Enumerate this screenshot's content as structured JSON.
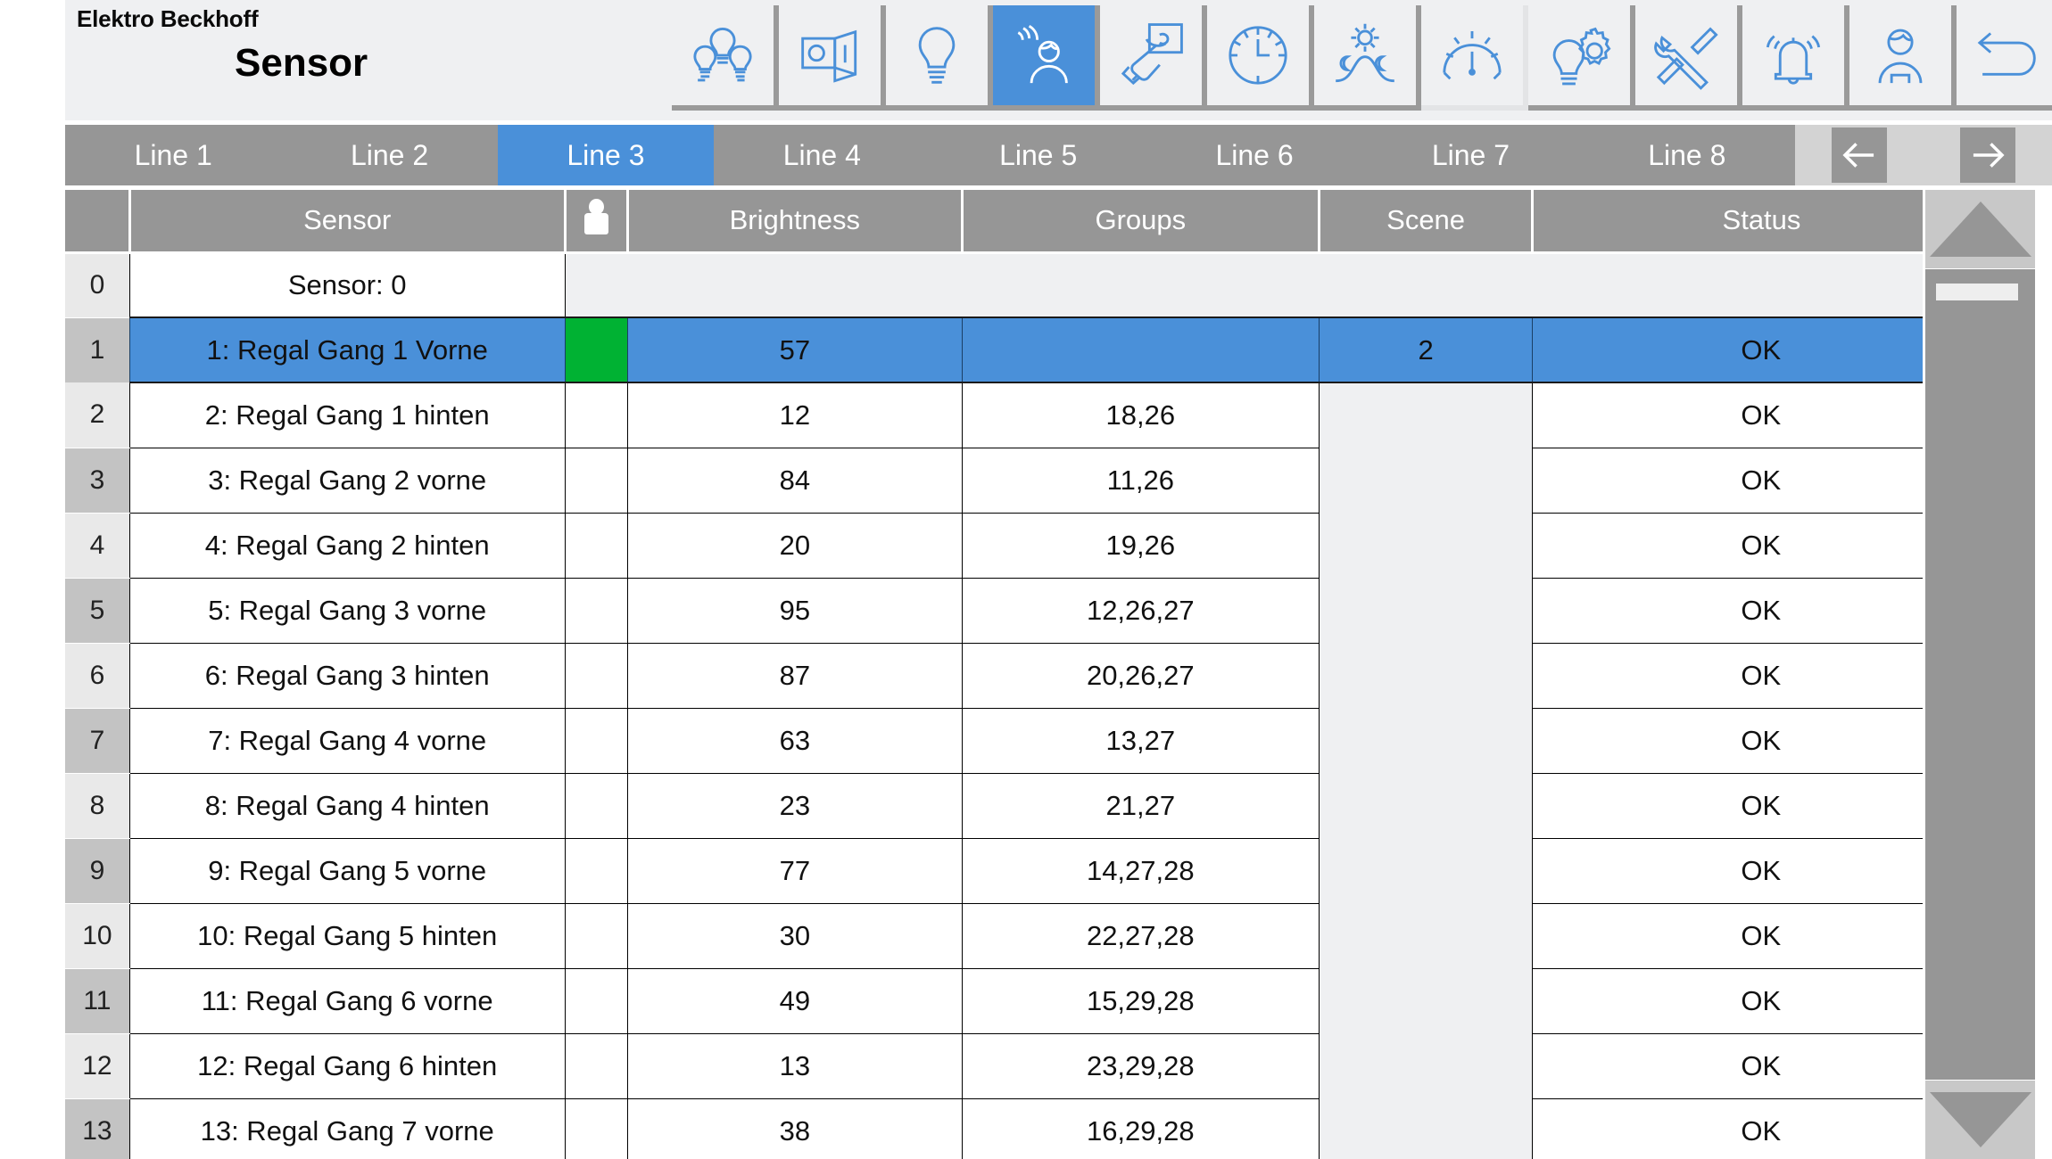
{
  "header": {
    "company": "Elektro Beckhoff",
    "title": "Sensor",
    "toolbar_buttons": [
      {
        "icon": "lamp-group-icon",
        "label": "Lamp groups",
        "active": false
      },
      {
        "icon": "display-panel-icon",
        "label": "Display panel",
        "active": false
      },
      {
        "icon": "lightbulb-icon",
        "label": "Light",
        "active": false
      },
      {
        "icon": "presence-sensor-icon",
        "label": "Sensor",
        "active": true
      },
      {
        "icon": "hand-switch-icon",
        "label": "Switch",
        "active": false
      },
      {
        "icon": "clock-icon",
        "label": "Time schedule",
        "active": false
      },
      {
        "icon": "sun-moon-curve-icon",
        "label": "Daylight curve",
        "active": false
      },
      {
        "icon": "gauge-icon",
        "label": "Gauge",
        "active": false
      },
      {
        "icon": "lightbulb-gear-icon",
        "label": "Light settings",
        "active": false
      },
      {
        "icon": "tools-icon",
        "label": "Service",
        "active": false
      },
      {
        "icon": "bell-alarm-icon",
        "label": "Alarms",
        "active": false
      },
      {
        "icon": "user-icon",
        "label": "User",
        "active": false
      },
      {
        "icon": "back-arrow-icon",
        "label": "Back",
        "active": false
      }
    ]
  },
  "line_tabs": {
    "items": [
      {
        "label": "Line 1",
        "active": false
      },
      {
        "label": "Line 2",
        "active": false
      },
      {
        "label": "Line 3",
        "active": true
      },
      {
        "label": "Line 4",
        "active": false
      },
      {
        "label": "Line 5",
        "active": false
      },
      {
        "label": "Line 6",
        "active": false
      },
      {
        "label": "Line 7",
        "active": false
      },
      {
        "label": "Line 8",
        "active": false
      }
    ],
    "prev_icon": "arrow-left-icon",
    "next_icon": "arrow-right-icon"
  },
  "table": {
    "columns": [
      {
        "key": "index",
        "label": ""
      },
      {
        "key": "sensor",
        "label": "Sensor"
      },
      {
        "key": "presence",
        "label": "",
        "icon": "person-icon"
      },
      {
        "key": "brightness",
        "label": "Brightness"
      },
      {
        "key": "groups",
        "label": "Groups"
      },
      {
        "key": "scene",
        "label": "Scene"
      },
      {
        "key": "status",
        "label": "Status"
      }
    ],
    "rows": [
      {
        "index": "0",
        "sensor": "Sensor: 0",
        "presence": false,
        "brightness": "",
        "groups": "",
        "scene": "",
        "status": "",
        "selected": false,
        "header_row": true
      },
      {
        "index": "1",
        "sensor": "1: Regal Gang 1 Vorne",
        "presence": true,
        "brightness": "57",
        "groups": "",
        "scene": "2",
        "status": "OK",
        "selected": true,
        "header_row": false
      },
      {
        "index": "2",
        "sensor": "2: Regal Gang 1 hinten",
        "presence": false,
        "brightness": "12",
        "groups": "18,26",
        "scene": "",
        "status": "OK",
        "selected": false,
        "header_row": false
      },
      {
        "index": "3",
        "sensor": "3: Regal Gang 2 vorne",
        "presence": false,
        "brightness": "84",
        "groups": "11,26",
        "scene": "",
        "status": "OK",
        "selected": false,
        "header_row": false
      },
      {
        "index": "4",
        "sensor": "4: Regal Gang 2 hinten",
        "presence": false,
        "brightness": "20",
        "groups": "19,26",
        "scene": "",
        "status": "OK",
        "selected": false,
        "header_row": false
      },
      {
        "index": "5",
        "sensor": "5: Regal Gang 3 vorne",
        "presence": false,
        "brightness": "95",
        "groups": "12,26,27",
        "scene": "",
        "status": "OK",
        "selected": false,
        "header_row": false
      },
      {
        "index": "6",
        "sensor": "6: Regal Gang 3 hinten",
        "presence": false,
        "brightness": "87",
        "groups": "20,26,27",
        "scene": "",
        "status": "OK",
        "selected": false,
        "header_row": false
      },
      {
        "index": "7",
        "sensor": "7: Regal Gang 4 vorne",
        "presence": false,
        "brightness": "63",
        "groups": "13,27",
        "scene": "",
        "status": "OK",
        "selected": false,
        "header_row": false
      },
      {
        "index": "8",
        "sensor": "8: Regal Gang 4 hinten",
        "presence": false,
        "brightness": "23",
        "groups": "21,27",
        "scene": "",
        "status": "OK",
        "selected": false,
        "header_row": false
      },
      {
        "index": "9",
        "sensor": "9: Regal Gang 5 vorne",
        "presence": false,
        "brightness": "77",
        "groups": "14,27,28",
        "scene": "",
        "status": "OK",
        "selected": false,
        "header_row": false
      },
      {
        "index": "10",
        "sensor": "10: Regal Gang 5 hinten",
        "presence": false,
        "brightness": "30",
        "groups": "22,27,28",
        "scene": "",
        "status": "OK",
        "selected": false,
        "header_row": false
      },
      {
        "index": "11",
        "sensor": "11: Regal Gang 6 vorne",
        "presence": false,
        "brightness": "49",
        "groups": "15,29,28",
        "scene": "",
        "status": "OK",
        "selected": false,
        "header_row": false
      },
      {
        "index": "12",
        "sensor": "12: Regal Gang 6 hinten",
        "presence": false,
        "brightness": "13",
        "groups": "23,29,28",
        "scene": "",
        "status": "OK",
        "selected": false,
        "header_row": false
      },
      {
        "index": "13",
        "sensor": "13: Regal Gang 7 vorne",
        "presence": false,
        "brightness": "38",
        "groups": "16,29,28",
        "scene": "",
        "status": "OK",
        "selected": false,
        "header_row": false
      }
    ]
  },
  "scrollbar": {
    "up_icon": "triangle-up-icon",
    "down_icon": "triangle-down-icon"
  },
  "colors": {
    "accent_blue": "#4a90d9",
    "header_gray": "#969696",
    "presence_green": "#00b233",
    "panel_bg": "#eff0f2"
  }
}
